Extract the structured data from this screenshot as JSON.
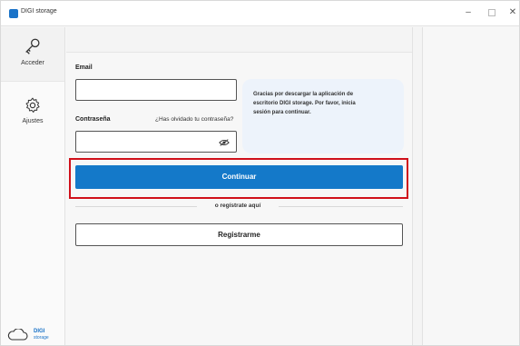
{
  "window": {
    "title": "DIGI storage",
    "minimize_symbol": "–",
    "close_symbol": "✕"
  },
  "sidebar": {
    "items": [
      {
        "label": "Acceder",
        "icon": "key-icon"
      },
      {
        "label": "Ajustes",
        "icon": "gear-icon"
      }
    ],
    "brand": {
      "name": "DIGI",
      "sub": "storage"
    }
  },
  "login": {
    "email_label": "Email",
    "email_value": "",
    "password_label": "Contraseña",
    "password_value": "",
    "forgot_link": "¿Has olvidado tu contraseña?",
    "info_text": "Gracias por descargar la aplicación de escritorio DIGI storage. Por favor, inicia sesión para continuar.",
    "continue_label": "Continuar",
    "divider_text": "o regístrate aquí",
    "register_label": "Registrarme"
  },
  "colors": {
    "accent": "#1479c9",
    "highlight": "#d0101a",
    "info_card": "#edf3fb"
  }
}
